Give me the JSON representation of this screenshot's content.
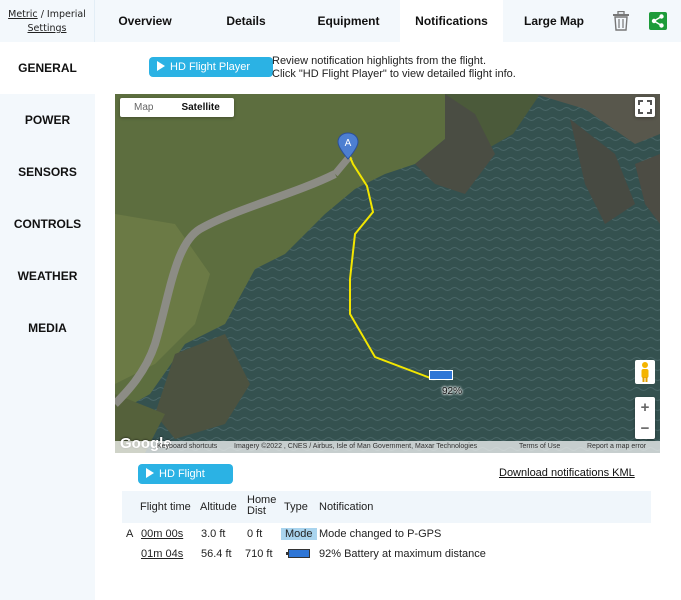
{
  "units": {
    "metric": "Metric",
    "separator": " / ",
    "imperial": "Imperial",
    "settings": "Settings"
  },
  "tabs": [
    {
      "label": "Overview",
      "active": false
    },
    {
      "label": "Details",
      "active": false
    },
    {
      "label": "Equipment",
      "active": false
    },
    {
      "label": "Notifications",
      "active": true
    },
    {
      "label": "Large Map",
      "active": false
    }
  ],
  "toolbar_icons": {
    "delete": "trash-icon",
    "share": "share-icon",
    "share_color": "#1d9b3a"
  },
  "sidebar": [
    {
      "label": "GENERAL",
      "active": true
    },
    {
      "label": "POWER",
      "active": false
    },
    {
      "label": "SENSORS",
      "active": false
    },
    {
      "label": "CONTROLS",
      "active": false
    },
    {
      "label": "WEATHER",
      "active": false
    },
    {
      "label": "MEDIA",
      "active": false
    }
  ],
  "hd_player_label": "HD Flight Player",
  "intro": {
    "line1": "Review notification highlights from the flight.",
    "line2": "Click \"HD Flight Player\" to view detailed flight info."
  },
  "map": {
    "type_map": "Map",
    "type_satellite": "Satellite",
    "selected_type": "Satellite",
    "marker_label": "A",
    "battery_label": "92%",
    "logo": "Google",
    "zoom_in": "+",
    "zoom_out": "−",
    "attribution": {
      "shortcuts": "Keyboard shortcuts",
      "imagery": "Imagery ©2022 , CNES / Airbus, Isle of Man Government, Maxar Technologies",
      "terms": "Terms of Use",
      "report": "Report a map error"
    },
    "path_color": "#f2e600"
  },
  "download_label": "Download notifications KML",
  "table": {
    "headers": {
      "time": "Flight time",
      "altitude": "Altitude",
      "home_line1": "Home",
      "home_line2": "Dist",
      "type": "Type",
      "notification": "Notification"
    },
    "rows": [
      {
        "marker": "A",
        "time": "00m 00s",
        "altitude": "3.0 ft",
        "home": "0 ft",
        "type": "Mode",
        "notification": "Mode changed to P-GPS"
      },
      {
        "marker": "",
        "time": "01m 04s",
        "altitude": "56.4 ft",
        "home": "710 ft",
        "type": "battery-icon",
        "notification": "92% Battery at maximum distance"
      }
    ]
  },
  "colors": {
    "accent": "#2bb2e4",
    "sidebar_bg": "#f3f8fc",
    "mode_badge": "#a9d4ee",
    "battery": "#2f76d6"
  }
}
